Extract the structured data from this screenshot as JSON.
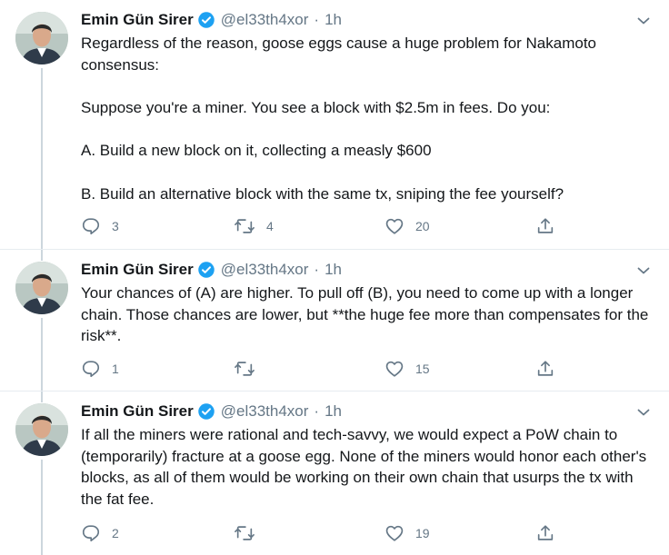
{
  "colors": {
    "verified_blue": "#1da1f2",
    "secondary_text": "#657786",
    "thread_line": "#ccd6dd"
  },
  "tweets": [
    {
      "author": {
        "name": "Emin Gün Sirer",
        "handle": "@el33th4xor",
        "verified": true
      },
      "separator": "·",
      "time": "1h",
      "paragraphs": [
        "Regardless of the reason, goose eggs cause a huge problem for Nakamoto consensus:",
        "Suppose you're a miner. You see a block with $2.5m in fees. Do you:",
        "A. Build a new block on it, collecting a measly $600",
        "B. Build an alternative block with the same tx, sniping the fee yourself?"
      ],
      "stats": {
        "replies": "3",
        "retweets": "4",
        "likes": "20"
      }
    },
    {
      "author": {
        "name": "Emin Gün Sirer",
        "handle": "@el33th4xor",
        "verified": true
      },
      "separator": "·",
      "time": "1h",
      "paragraphs": [
        "Your chances of (A) are higher. To pull off (B), you need to come up with a longer chain. Those chances are lower, but **the huge fee more than compensates for the risk**."
      ],
      "stats": {
        "replies": "1",
        "retweets": "",
        "likes": "15"
      }
    },
    {
      "author": {
        "name": "Emin Gün Sirer",
        "handle": "@el33th4xor",
        "verified": true
      },
      "separator": "·",
      "time": "1h",
      "paragraphs": [
        "If all the miners were rational and tech-savvy, we would expect a PoW chain to (temporarily) fracture at a goose egg. None of the miners would honor each other's blocks, as all of them would be working on their own chain that usurps the tx with the fat fee."
      ],
      "stats": {
        "replies": "2",
        "retweets": "",
        "likes": "19"
      }
    }
  ],
  "icons": {
    "reply": "reply-icon",
    "retweet": "retweet-icon",
    "like": "heart-icon",
    "share": "share-icon",
    "caret": "chevron-down-icon",
    "verified": "verified-badge-icon"
  }
}
